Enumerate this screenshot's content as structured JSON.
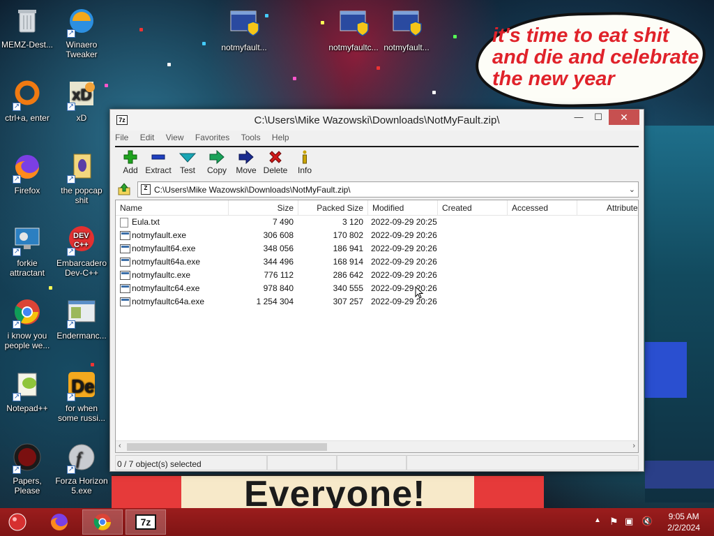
{
  "wallpaper": {
    "speech_bubble_text": "it's time to eat shit and die and celebrate the new year",
    "banner_text": "Everyone!"
  },
  "desktop_icons": [
    {
      "label": "MEMZ-Dest...",
      "icon": "recycle-bin-icon"
    },
    {
      "label": "Winaero Tweaker",
      "icon": "winaero-icon"
    },
    {
      "label": "notmyfault...",
      "icon": "uac-exe-icon"
    },
    {
      "label": "notmyfaultc...",
      "icon": "uac-exe-icon"
    },
    {
      "label": "notmyfault...",
      "icon": "uac-exe-icon"
    },
    {
      "label": "ctrl+a, enter",
      "icon": "ring-icon"
    },
    {
      "label": "xD",
      "icon": "xd-icon"
    },
    {
      "label": "Firefox",
      "icon": "firefox-icon"
    },
    {
      "label": "the popcap shit",
      "icon": "popcap-icon"
    },
    {
      "label": "forkie attractant",
      "icon": "settings-monitor-icon"
    },
    {
      "label": "Embarcadero Dev-C++",
      "icon": "devcpp-icon"
    },
    {
      "label": "i know you people we...",
      "icon": "chrome-icon"
    },
    {
      "label": "Endermanc...",
      "icon": "window-icon"
    },
    {
      "label": "Notepad++",
      "icon": "notepadpp-icon"
    },
    {
      "label": "for when some russi...",
      "icon": "de-icon"
    },
    {
      "label": "Papers, Please",
      "icon": "papers-please-icon"
    },
    {
      "label": "Forza Horizon 5.exe",
      "icon": "flash-icon"
    }
  ],
  "window": {
    "title": "C:\\Users\\Mike Wazowski\\Downloads\\NotMyFault.zip\\",
    "app_icon_text": "7z",
    "minimize": "—",
    "maximize": "☐",
    "close": "✕"
  },
  "menu": [
    "File",
    "Edit",
    "View",
    "Favorites",
    "Tools",
    "Help"
  ],
  "toolbar": [
    {
      "label": "Add",
      "icon": "add-icon",
      "color": "#1fa31f"
    },
    {
      "label": "Extract",
      "icon": "extract-icon",
      "color": "#1f3fbf"
    },
    {
      "label": "Test",
      "icon": "test-icon",
      "color": "#19a6b5"
    },
    {
      "label": "Copy",
      "icon": "copy-icon",
      "color": "#1aa35a"
    },
    {
      "label": "Move",
      "icon": "move-icon",
      "color": "#1b2c8f"
    },
    {
      "label": "Delete",
      "icon": "delete-icon",
      "color": "#d01a1a"
    },
    {
      "label": "Info",
      "icon": "info-icon",
      "color": "#c9a400"
    }
  ],
  "address": {
    "path": "C:\\Users\\Mike Wazowski\\Downloads\\NotMyFault.zip\\"
  },
  "columns": [
    "Name",
    "Size",
    "Packed Size",
    "Modified",
    "Created",
    "Accessed",
    "Attribute"
  ],
  "files": [
    {
      "name": "Eula.txt",
      "type": "txt",
      "size": "7 490",
      "packed": "3 120",
      "modified": "2022-09-29 20:25"
    },
    {
      "name": "notmyfault.exe",
      "type": "exe",
      "size": "306 608",
      "packed": "170 802",
      "modified": "2022-09-29 20:26"
    },
    {
      "name": "notmyfault64.exe",
      "type": "exe",
      "size": "348 056",
      "packed": "186 941",
      "modified": "2022-09-29 20:26"
    },
    {
      "name": "notmyfault64a.exe",
      "type": "exe",
      "size": "344 496",
      "packed": "168 914",
      "modified": "2022-09-29 20:26"
    },
    {
      "name": "notmyfaultc.exe",
      "type": "exe",
      "size": "776 112",
      "packed": "286 642",
      "modified": "2022-09-29 20:26"
    },
    {
      "name": "notmyfaultc64.exe",
      "type": "exe",
      "size": "978 840",
      "packed": "340 555",
      "modified": "2022-09-29 20:26"
    },
    {
      "name": "notmyfaultc64a.exe",
      "type": "exe",
      "size": "1 254 304",
      "packed": "307 257",
      "modified": "2022-09-29 20:26"
    }
  ],
  "status": {
    "selection": "0 / 7 object(s) selected"
  },
  "taskbar": {
    "items": [
      {
        "name": "start",
        "icon": "start-orb-icon"
      },
      {
        "name": "firefox",
        "icon": "firefox-icon"
      },
      {
        "name": "chrome",
        "icon": "chrome-icon",
        "active": true
      },
      {
        "name": "7zip",
        "icon": "7zip-icon",
        "label": "7z"
      }
    ],
    "time": "9:05 AM",
    "date": "2/2/2024",
    "colors": {
      "taskbar": "#8c1818"
    }
  }
}
